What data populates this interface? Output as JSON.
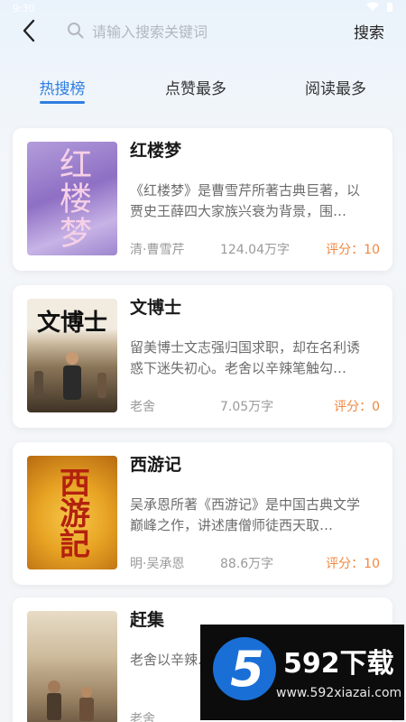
{
  "status_bar": {
    "time": "9:30"
  },
  "search": {
    "placeholder": "请输入搜索关键词",
    "button_label": "搜索"
  },
  "tabs": [
    {
      "label": "热搜榜",
      "active": true
    },
    {
      "label": "点赞最多",
      "active": false
    },
    {
      "label": "阅读最多",
      "active": false
    }
  ],
  "books": [
    {
      "title": "红楼梦",
      "cover_text": "红楼梦",
      "description": "《红楼梦》是曹雪芹所著古典巨著，以贾史王薛四大家族兴衰为背景，围…",
      "author": "清·曹雪芹",
      "words": "124.04万字",
      "score": "评分：10"
    },
    {
      "title": "文博士",
      "cover_text": "文博士",
      "description": "留美博士文志强归国求职，却在名利诱惑下迷失初心。老舍以辛辣笔触勾…",
      "author": "老舍",
      "words": "7.05万字",
      "score": "评分：0"
    },
    {
      "title": "西游记",
      "cover_text": "西游記",
      "description": "吴承恩所著《西游记》是中国古典文学巅峰之作，讲述唐僧师徒西天取…",
      "author": "明·吴承恩",
      "words": "88.6万字",
      "score": "评分：10"
    },
    {
      "title": "赶集",
      "cover_text": "",
      "description": "老舍以辛辣…民烟火日常…",
      "author": "老舍",
      "words": "",
      "score": ""
    }
  ],
  "watermark": {
    "logo_number": "5",
    "brand": "592下载",
    "url": "www.592xiazai.com"
  },
  "colors": {
    "accent": "#2f7ee0",
    "score": "#f0873f"
  }
}
